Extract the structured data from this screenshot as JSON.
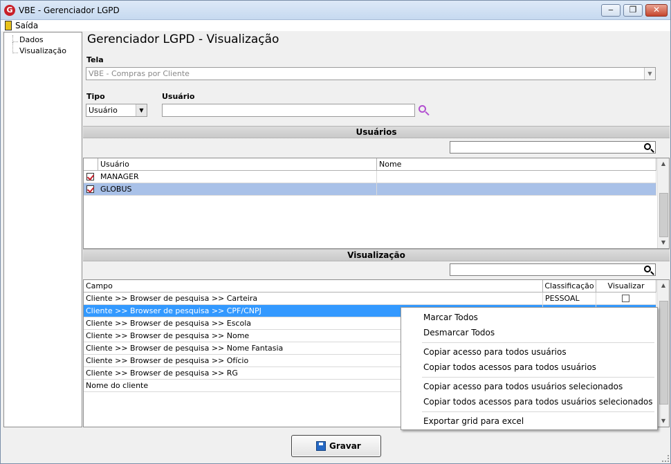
{
  "window": {
    "title": "VBE - Gerenciador LGPD",
    "app_icon": "G"
  },
  "menu": {
    "exit_label": "Saída"
  },
  "tree": {
    "items": [
      "Dados",
      "Visualização"
    ]
  },
  "page": {
    "title": "Gerenciador LGPD - Visualização"
  },
  "tela": {
    "label": "Tela",
    "value": "VBE - Compras por Cliente"
  },
  "tipo": {
    "label": "Tipo",
    "value": "Usuário"
  },
  "usuario": {
    "label": "Usuário",
    "value": ""
  },
  "users_section": {
    "title": "Usuários",
    "search_value": "",
    "columns": [
      "Usuário",
      "Nome"
    ],
    "rows": [
      {
        "checked": true,
        "usuario": "MANAGER",
        "nome": ""
      },
      {
        "checked": true,
        "usuario": "GLOBUS",
        "nome": "",
        "selected": true
      }
    ]
  },
  "view_section": {
    "title": "Visualização",
    "search_value": "",
    "columns": [
      "Campo",
      "Classificação",
      "Visualizar"
    ],
    "rows": [
      {
        "campo": "Cliente >> Browser de pesquisa >> Carteira",
        "classificacao": "PESSOAL",
        "visualizar": false
      },
      {
        "campo": "Cliente >> Browser de pesquisa >> CPF/CNPJ",
        "classificacao": "",
        "visualizar": false,
        "selected": true
      },
      {
        "campo": "Cliente >> Browser de pesquisa >> Escola",
        "classificacao": "",
        "visualizar": false
      },
      {
        "campo": "Cliente >> Browser de pesquisa >> Nome",
        "classificacao": "",
        "visualizar": false
      },
      {
        "campo": "Cliente >> Browser de pesquisa >> Nome Fantasia",
        "classificacao": "",
        "visualizar": false
      },
      {
        "campo": "Cliente >> Browser de pesquisa >> Ofício",
        "classificacao": "",
        "visualizar": false
      },
      {
        "campo": "Cliente >> Browser de pesquisa >> RG",
        "classificacao": "",
        "visualizar": false
      },
      {
        "campo": "Nome do cliente",
        "classificacao": "",
        "visualizar": false
      }
    ]
  },
  "context_menu": {
    "items": [
      "Marcar Todos",
      "Desmarcar Todos",
      "Copiar acesso para todos usuários",
      "Copiar todos acessos para todos usuários",
      "Copiar acesso para todos usuários selecionados",
      "Copiar todos acessos para todos usuários selecionados",
      "Exportar grid para excel"
    ]
  },
  "save_button": {
    "label": "Gravar"
  },
  "colors": {
    "selection": "#3399ff",
    "user_selection": "#a9c1e8",
    "brand": "#c8202a"
  }
}
